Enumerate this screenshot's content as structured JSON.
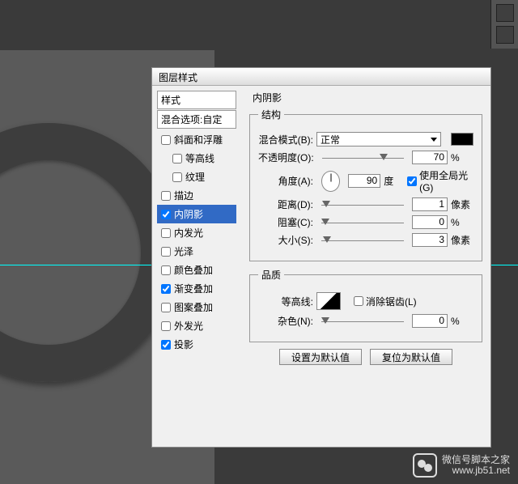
{
  "dialog": {
    "title": "图层样式",
    "styles_header": "样式",
    "blend_options": "混合选项:自定",
    "items": [
      {
        "label": "斜面和浮雕",
        "checked": false,
        "selected": false,
        "key": "bevel"
      },
      {
        "label": "等高线",
        "checked": false,
        "selected": false,
        "key": "contour",
        "indent": true
      },
      {
        "label": "纹理",
        "checked": false,
        "selected": false,
        "key": "texture",
        "indent": true
      },
      {
        "label": "描边",
        "checked": false,
        "selected": false,
        "key": "stroke"
      },
      {
        "label": "内阴影",
        "checked": true,
        "selected": true,
        "key": "inner-shadow"
      },
      {
        "label": "内发光",
        "checked": false,
        "selected": false,
        "key": "inner-glow"
      },
      {
        "label": "光泽",
        "checked": false,
        "selected": false,
        "key": "satin"
      },
      {
        "label": "颜色叠加",
        "checked": false,
        "selected": false,
        "key": "color-overlay"
      },
      {
        "label": "渐变叠加",
        "checked": true,
        "selected": false,
        "key": "gradient-overlay"
      },
      {
        "label": "图案叠加",
        "checked": false,
        "selected": false,
        "key": "pattern-overlay"
      },
      {
        "label": "外发光",
        "checked": false,
        "selected": false,
        "key": "outer-glow"
      },
      {
        "label": "投影",
        "checked": true,
        "selected": false,
        "key": "drop-shadow"
      }
    ]
  },
  "panel_title": "内阴影",
  "structure": {
    "legend": "结构",
    "blend_mode_label": "混合模式(B):",
    "blend_mode_value": "正常",
    "opacity_label": "不透明度(O):",
    "opacity_value": "70",
    "opacity_unit": "%",
    "angle_label": "角度(A):",
    "angle_value": "90",
    "angle_unit": "度",
    "global_light_label": "使用全局光(G)",
    "global_light_checked": true,
    "distance_label": "距离(D):",
    "distance_value": "1",
    "distance_unit": "像素",
    "choke_label": "阻塞(C):",
    "choke_value": "0",
    "choke_unit": "%",
    "size_label": "大小(S):",
    "size_value": "3",
    "size_unit": "像素"
  },
  "quality": {
    "legend": "品质",
    "contour_label": "等高线:",
    "antialias_label": "消除锯齿(L)",
    "antialias_checked": false,
    "noise_label": "杂色(N):",
    "noise_value": "0",
    "noise_unit": "%"
  },
  "buttons": {
    "defaults": "设置为默认值",
    "reset": "复位为默认值"
  },
  "watermark": {
    "line1": "微信号脚本之家",
    "line2": "www.jb51.net"
  }
}
